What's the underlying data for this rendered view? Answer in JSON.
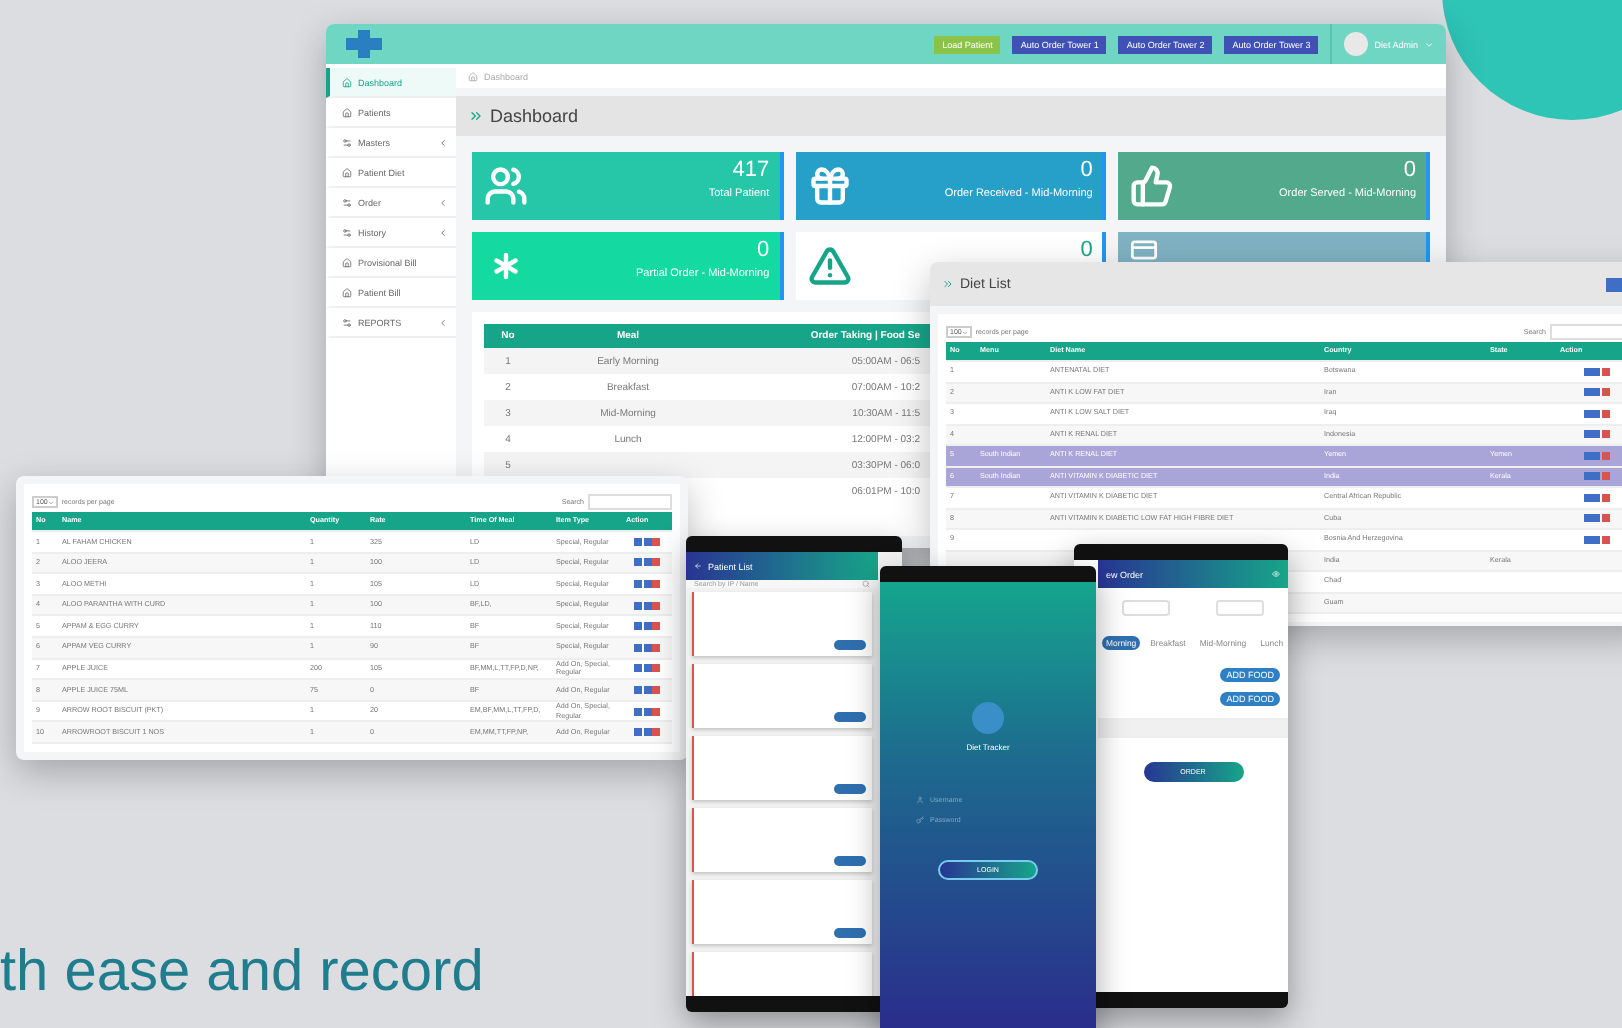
{
  "dashboard": {
    "top_buttons": [
      {
        "label": "Load Patient",
        "kind": "green"
      },
      {
        "label": "Auto Order Tower 1",
        "kind": "blue"
      },
      {
        "label": "Auto Order Tower 2",
        "kind": "blue"
      },
      {
        "label": "Auto Order Tower 3",
        "kind": "blue"
      }
    ],
    "user": "Diet Admin",
    "sidebar": {
      "items": [
        {
          "label": "Dashboard",
          "selected": true,
          "expandable": false
        },
        {
          "label": "Patients",
          "selected": false,
          "expandable": false
        },
        {
          "label": "Masters",
          "selected": false,
          "expandable": true
        },
        {
          "label": "Patient Diet",
          "selected": false,
          "expandable": false
        },
        {
          "label": "Order",
          "selected": false,
          "expandable": true
        },
        {
          "label": "History",
          "selected": false,
          "expandable": true
        },
        {
          "label": "Provisional Bill",
          "selected": false,
          "expandable": false
        },
        {
          "label": "Patient Bill",
          "selected": false,
          "expandable": false
        },
        {
          "label": "REPORTS",
          "selected": false,
          "expandable": true
        }
      ]
    },
    "breadcrumb": "Dashboard",
    "heading": "Dashboard",
    "tiles": [
      {
        "kind": "patients",
        "value": "417",
        "label": "Total Patient",
        "color": "#26c6a8"
      },
      {
        "kind": "received",
        "value": "0",
        "label": "Order Received - Mid-Morning",
        "color": "#26a0c8"
      },
      {
        "kind": "served",
        "value": "0",
        "label": "Order Served - Mid-Morning",
        "color": "#52a98c"
      },
      {
        "kind": "partial",
        "value": "0",
        "label": "Partial Order - Mid-Morning",
        "color": "#14d9a0"
      },
      {
        "kind": "alert",
        "value": "0",
        "color": "#ffffff"
      },
      {
        "kind": "card",
        "color": "#7fb2c2"
      }
    ],
    "meal_table": {
      "columns": [
        "No",
        "Meal",
        "Order Taking | Food Se"
      ],
      "rows": [
        {
          "no": "1",
          "meal": "Early Morning",
          "time": "05:00AM - 06:5"
        },
        {
          "no": "2",
          "meal": "Breakfast",
          "time": "07:00AM - 10:2"
        },
        {
          "no": "3",
          "meal": "Mid-Morning",
          "time": "10:30AM - 11:5"
        },
        {
          "no": "4",
          "meal": "Lunch",
          "time": "12:00PM - 03:2"
        },
        {
          "no": "5",
          "time": "03:30PM - 06:0"
        },
        {
          "time": "06:01PM - 10:0"
        }
      ]
    }
  },
  "diet_list": {
    "title": "Diet List",
    "page_size": "100",
    "page_size_label": "records per page",
    "search_label": "Search",
    "columns": [
      "No",
      "Menu",
      "Diet Name",
      "Country",
      "State",
      "Action"
    ],
    "rows": [
      {
        "no": "1",
        "diet_name": "ANTENATAL DIET",
        "country": "Botswana",
        "selected": false
      },
      {
        "no": "2",
        "diet_name": "ANTI K LOW FAT DIET",
        "country": "Iran",
        "selected": false
      },
      {
        "no": "3",
        "diet_name": "ANTI K LOW SALT DIET",
        "country": "Iraq",
        "selected": false
      },
      {
        "no": "4",
        "diet_name": "ANTI K RENAL DIET",
        "country": "Indonesia",
        "selected": false
      },
      {
        "no": "5",
        "menu": "South Indian",
        "diet_name": "ANTI K RENAL DIET",
        "country": "Yemen",
        "state": "Yemen",
        "selected": true
      },
      {
        "no": "6",
        "menu": "South Indian",
        "diet_name": "ANTI VITAMIN K DIABETIC DIET",
        "country": "India",
        "state": "Kerala",
        "selected": true
      },
      {
        "no": "7",
        "diet_name": "ANTI VITAMIN K DIABETIC DIET",
        "country": "Central African Republic",
        "selected": false
      },
      {
        "no": "8",
        "diet_name": "ANTI VITAMIN K DIABETIC LOW FAT HIGH FIBRE DIET",
        "country": "Cuba",
        "selected": false
      },
      {
        "no": "9",
        "country": "Bosnia And Herzegovina",
        "selected": false
      },
      {
        "country": "India",
        "state": "Kerala",
        "selected": false
      },
      {
        "country": "Chad",
        "selected": false
      },
      {
        "country": "Guam",
        "selected": false
      }
    ]
  },
  "item_list": {
    "page_size": "100",
    "page_size_label": "records per page",
    "search_label": "Search",
    "columns": [
      "No",
      "Name",
      "Quantity",
      "Rate",
      "Time Of Meal",
      "Item Type",
      "Action"
    ],
    "rows": [
      [
        "1",
        "AL FAHAM CHICKEN",
        "1",
        "325",
        "LD",
        "Special, Regular"
      ],
      [
        "2",
        "ALOO JEERA",
        "1",
        "100",
        "LD",
        "Special, Regular"
      ],
      [
        "3",
        "ALOO METHI",
        "1",
        "105",
        "LD",
        "Special, Regular"
      ],
      [
        "4",
        "ALOO PARANTHA WITH CURD",
        "1",
        "100",
        "BF,LD,",
        "Special, Regular"
      ],
      [
        "5",
        "APPAM & EGG CURRY",
        "1",
        "110",
        "BF",
        "Special, Regular"
      ],
      [
        "6",
        "APPAM VEG CURRY",
        "1",
        "90",
        "BF",
        "Special, Regular"
      ],
      [
        "7",
        "APPLE JUICE",
        "200",
        "105",
        "BF,MM,L,TT,FP,D,NP,",
        "Add On, Special, Regular"
      ],
      [
        "8",
        "APPLE JUICE 75ML",
        "75",
        "0",
        "BF",
        "Add On, Regular"
      ],
      [
        "9",
        "ARROW ROOT BISCUIT (PKT)",
        "1",
        "20",
        "EM,BF,MM,L,TT,FP,D,",
        "Add On, Special, Regular"
      ],
      [
        "10",
        "ARROWROOT BISCUIT 1 NOS",
        "1",
        "0",
        "EM,MM,TT,FP,NP,",
        "Add On, Regular"
      ]
    ]
  },
  "patient_phone": {
    "title": "Patient List",
    "search_placeholder": "Search by IP / Name"
  },
  "login_phone": {
    "app_name": "Diet Tracker",
    "username_placeholder": "Username",
    "password_placeholder": "Password",
    "button": "LOGIN"
  },
  "order_phone": {
    "title": "ew Order",
    "tabs": [
      {
        "label": "Morning",
        "selected": true
      },
      {
        "label": "Breakfast",
        "selected": false
      },
      {
        "label": "Mid-Morning",
        "selected": false
      },
      {
        "label": "Lunch",
        "selected": false
      }
    ],
    "add_buttons": [
      "ADD FOOD",
      "ADD FOOD"
    ],
    "order_button": "ORDER"
  },
  "headline": "th ease and record"
}
